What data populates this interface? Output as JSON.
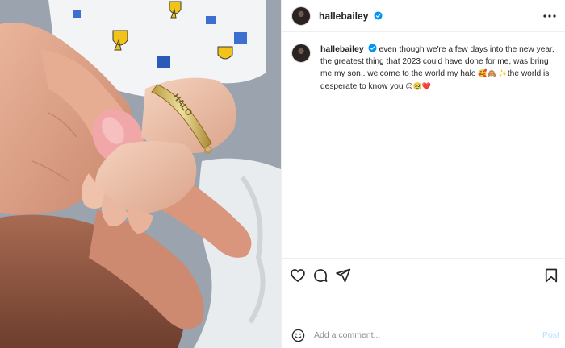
{
  "post": {
    "username": "hallebailey",
    "verified": true,
    "caption_text": "even though we're a few days into the new year, the greatest thing that 2023 could have done for me, was bring me my son.. welcome to the world my halo ",
    "caption_emoji_1": "🥰🙈 ✨",
    "caption_text_2": "the world is desperate to know you ",
    "caption_emoji_2": "😌🥹❤️",
    "bracelet_text": "HALO"
  },
  "icons": {
    "more": "more-horizontal-icon",
    "like": "heart-icon",
    "comment": "comment-bubble-icon",
    "share": "paper-plane-icon",
    "save": "bookmark-icon",
    "emoji": "smiley-icon",
    "verified": "verified-badge-icon"
  },
  "comment_box": {
    "placeholder": "Add a comment...",
    "post_label": "Post"
  },
  "colors": {
    "accent": "#0095f6",
    "post_disabled": "#b2dffc",
    "text": "#262626",
    "muted": "#8e8e8e"
  }
}
